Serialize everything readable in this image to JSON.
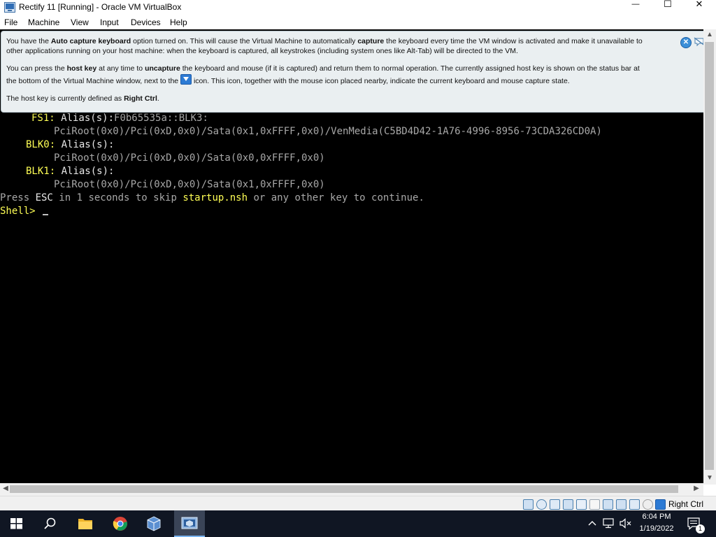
{
  "window": {
    "title": "Rectify 11 [Running] - Oracle VM VirtualBox",
    "minimize_glyph": "—",
    "maximize_glyph": "☐",
    "close_glyph": "✕"
  },
  "menu": {
    "items": [
      "File",
      "Machine",
      "View",
      "Input",
      "Devices",
      "Help"
    ]
  },
  "notice": {
    "p1": {
      "a": "You have the ",
      "b": "Auto capture keyboard",
      "c": " option turned on. This will cause the Virtual Machine to automatically ",
      "d": "capture",
      "e": " the keyboard every time the VM window is activated and make it unavailable to",
      "f": "other applications running on your host machine: when the keyboard is captured, all keystrokes (including system ones like Alt-Tab) will be directed to the VM."
    },
    "p2": {
      "a": "You can press the ",
      "b": "host key",
      "c": " at any time to ",
      "d": "uncapture",
      "e": " the keyboard and mouse (if it is captured) and return them to normal operation. The currently assigned host key is shown on the status bar at",
      "f": "the bottom of the Virtual Machine window, next to the ",
      "g": " icon. This icon, together with the mouse icon placed nearby, indicate the current keyboard and mouse capture state."
    },
    "p3": {
      "a": "The host key is currently defined as ",
      "b": "Right Ctrl",
      "c": "."
    }
  },
  "terminal": {
    "fs1_label": "FS1:",
    "fs1_alias": " Alias(s):",
    "fs1_alias_val": "F0b65535a::BLK3:",
    "fs1_path": "PciRoot(0x0)/Pci(0xD,0x0)/Sata(0x1,0xFFFF,0x0)/VenMedia(C5BD4D42-1A76-4996-8956-73CDA326CD0A)",
    "blk0_label": "BLK0:",
    "blk0_alias": " Alias(s):",
    "blk0_path": "PciRoot(0x0)/Pci(0xD,0x0)/Sata(0x0,0xFFFF,0x0)",
    "blk1_label": "BLK1:",
    "blk1_alias": " Alias(s):",
    "blk1_path": "PciRoot(0x0)/Pci(0xD,0x0)/Sata(0x1,0xFFFF,0x0)",
    "press_a": "Press ",
    "press_esc": "ESC",
    "press_b": " in 1 seconds to skip ",
    "press_nsh": "startup.nsh",
    "press_c": " or any other key to continue.",
    "prompt": "Shell> "
  },
  "statusbar": {
    "hostkey_label": "Right Ctrl",
    "icons": [
      "hard-disk-icon",
      "optical-drive-icon",
      "audio-icon",
      "network-icon",
      "usb-icon",
      "shared-folders-icon",
      "display-icon",
      "video-capture-icon",
      "cpu-icon",
      "mouse-integration-icon",
      "keyboard-capture-icon"
    ]
  },
  "taskbar": {
    "time": "6:04 PM",
    "date": "1/19/2022",
    "notification_count": "1",
    "apps": [
      "start-icon",
      "search-icon",
      "file-explorer-icon",
      "chrome-icon",
      "virtualbox-icon",
      "virtualbox-vm-icon"
    ]
  },
  "colors": {
    "terminal_bg": "#000000",
    "terminal_yellow": "#ffff55",
    "terminal_white": "#e8e8e8",
    "notice_bg": "#eaeff1",
    "taskbar_bg": "#101623"
  }
}
